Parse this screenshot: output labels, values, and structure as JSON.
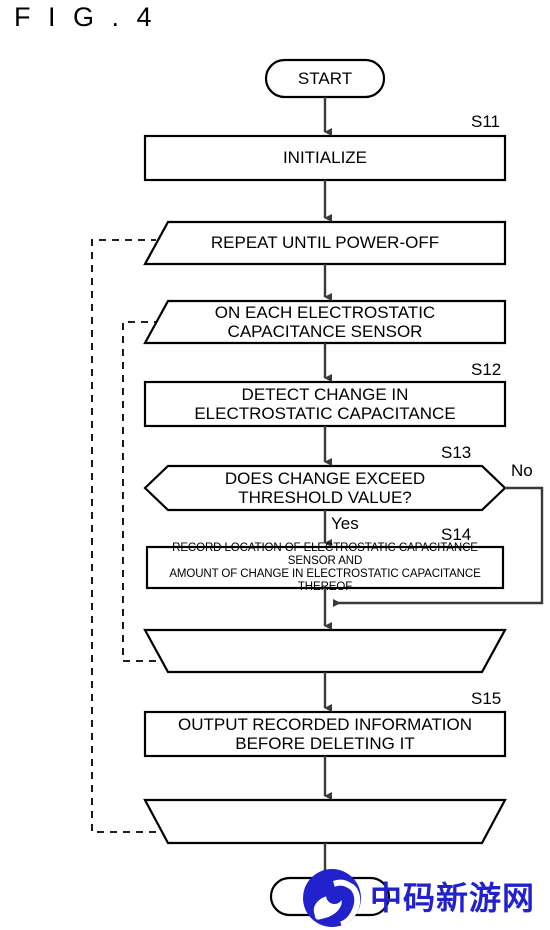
{
  "figure": {
    "title": "F I G . 4"
  },
  "nodes": {
    "start": {
      "label": "START",
      "shape": "stadium"
    },
    "initialize": {
      "label": "INITIALIZE",
      "shape": "process",
      "step": "S11"
    },
    "repeat_loop_start": {
      "label": "REPEAT UNTIL POWER-OFF",
      "shape": "loop-start"
    },
    "on_each_sensor": {
      "label": "ON EACH ELECTROSTATIC\nCAPACITANCE SENSOR",
      "shape": "loop-start"
    },
    "detect_change": {
      "label": "DETECT CHANGE IN\nELECTROSTATIC CAPACITANCE",
      "shape": "process",
      "step": "S12"
    },
    "decision_threshold": {
      "label": "DOES CHANGE EXCEED\nTHRESHOLD VALUE?",
      "shape": "decision",
      "step": "S13"
    },
    "record_location": {
      "label": "RECORD LOCATION OF ELECTROSTATIC CAPACITANCE SENSOR AND\nAMOUNT OF CHANGE IN ELECTROSTATIC CAPACITANCE THEREOF",
      "shape": "process",
      "step": "S14"
    },
    "inner_loop_end": {
      "label": "",
      "shape": "loop-end"
    },
    "output_information": {
      "label": "OUTPUT RECORDED INFORMATION\nBEFORE DELETING IT",
      "shape": "process",
      "step": "S15"
    },
    "outer_loop_end": {
      "label": "",
      "shape": "loop-end"
    },
    "end": {
      "label": "",
      "shape": "stadium"
    }
  },
  "branches": {
    "yes": "Yes",
    "no": "No"
  },
  "step_labels": {
    "s11": "S11",
    "s12": "S12",
    "s13": "S13",
    "s14": "S14",
    "s15": "S15"
  },
  "watermark": {
    "text": "中码新游网",
    "logo_name": "circular-e-swoosh-logo",
    "color": "#2222cc"
  },
  "colors": {
    "stroke": "#000000",
    "connector": "#3a3a3a",
    "background": "#ffffff",
    "watermark": "#2222cc"
  }
}
